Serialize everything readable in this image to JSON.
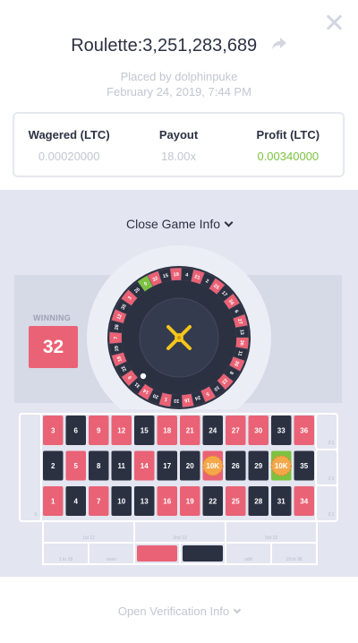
{
  "header": {
    "title": "Roulette:3,251,283,689",
    "placed_by": "Placed by dolphinpuke",
    "date": "February 24, 2019, 7:44 PM"
  },
  "stats": [
    {
      "label": "Wagered (LTC)",
      "value": "0.00020000"
    },
    {
      "label": "Payout",
      "value": "18.00x"
    },
    {
      "label": "Profit (LTC)",
      "value": "0.00340000"
    }
  ],
  "game_info": {
    "close_label": "Close Game Info",
    "winning_label": "WINNING",
    "winning_number": "32"
  },
  "wheel_numbers": [
    "0",
    "32",
    "15",
    "19",
    "4",
    "21",
    "2",
    "25",
    "17",
    "34",
    "6",
    "27",
    "13",
    "36",
    "11",
    "30",
    "8",
    "23",
    "10",
    "5",
    "24",
    "16",
    "33",
    "1",
    "20",
    "14",
    "31",
    "9",
    "22",
    "18",
    "29",
    "7",
    "28",
    "12",
    "35",
    "3",
    "26"
  ],
  "board": {
    "rows": [
      [
        "3",
        "6",
        "9",
        "12",
        "15",
        "18",
        "21",
        "24",
        "27",
        "30",
        "33",
        "36"
      ],
      [
        "2",
        "5",
        "8",
        "11",
        "14",
        "17",
        "20",
        "23",
        "26",
        "29",
        "32",
        "35"
      ],
      [
        "1",
        "4",
        "7",
        "10",
        "13",
        "16",
        "19",
        "22",
        "25",
        "28",
        "31",
        "34"
      ]
    ],
    "red_numbers": [
      "1",
      "3",
      "5",
      "7",
      "9",
      "12",
      "14",
      "16",
      "18",
      "19",
      "21",
      "23",
      "25",
      "27",
      "30",
      "32",
      "34",
      "36"
    ],
    "chips": [
      {
        "number": "23",
        "label": "10K"
      },
      {
        "number": "32",
        "label": "10K"
      }
    ],
    "winning_number": "32",
    "column_labels": [
      "2:1",
      "2:1",
      "2:1"
    ],
    "zero_label": "0",
    "dozen_labels": [
      "1st 12",
      "2nd 12",
      "3rd 12"
    ],
    "outside_labels": [
      "1 to 18",
      "even",
      "",
      "",
      "odd",
      "19 to 36"
    ]
  },
  "footer": {
    "verify_label": "Open Verification Info"
  },
  "colors": {
    "red": "#ea6275",
    "black": "#2c3142",
    "green": "#7cc240",
    "chip": "#f5a84a"
  }
}
